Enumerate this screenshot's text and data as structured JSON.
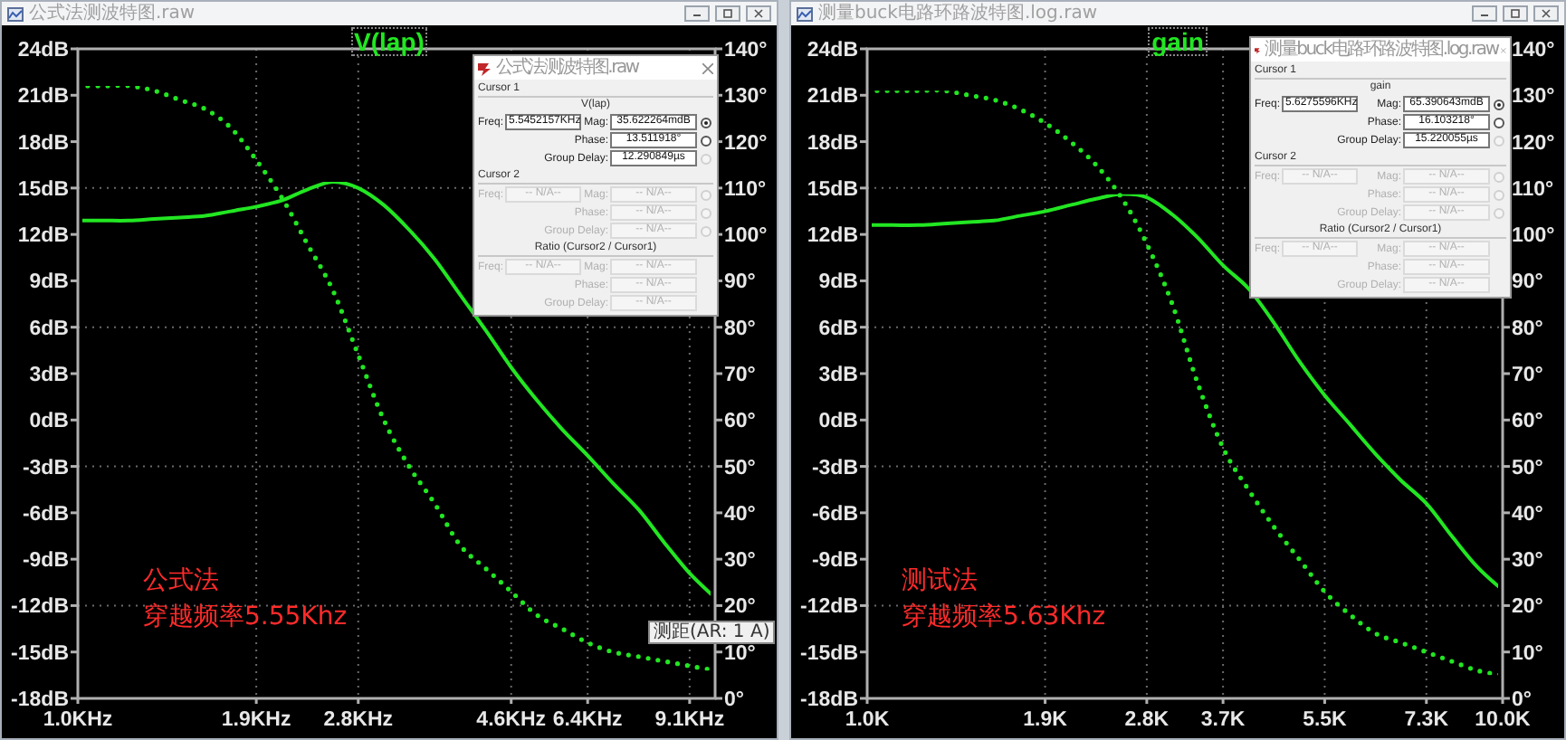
{
  "windows": [
    {
      "title": "公式法测波特图.raw",
      "plot": {
        "trace_label": "V(lap)",
        "chart_data": {
          "type": "line",
          "grid": true,
          "ylim": [
            -18,
            24
          ],
          "y2lim": [
            0,
            140
          ],
          "categories": [
            "1.0KHz",
            null,
            null,
            null,
            null,
            null,
            null,
            "1.9KHz",
            null,
            null,
            null,
            "2.8KHz",
            null,
            null,
            null,
            null,
            null,
            "4.6KHz",
            null,
            null,
            "6.4KHz",
            null,
            null,
            null,
            "9.1KHz",
            null
          ],
          "series": [
            {
              "color": "#22e622",
              "values": [
                12.9,
                12.9,
                12.9,
                13.0,
                13.1,
                13.2,
                13.5,
                13.8,
                14.2,
                14.9,
                15.4,
                15.0,
                13.9,
                12.3,
                10.4,
                8.1,
                5.8,
                3.4,
                1.3,
                -0.6,
                -2.3,
                -4.1,
                -5.8,
                -7.9,
                -9.9,
                -11.5
              ]
            },
            {
              "color": "#22e622",
              "axis": "y2",
              "line_style": "dotted",
              "values": [
                132,
                132,
                132,
                131,
                129,
                127,
                123,
                116,
                108,
                98,
                88,
                74,
                60,
                50,
                42,
                33,
                28,
                23,
                18,
                15,
                12,
                10,
                9,
                8,
                7,
                6
              ]
            }
          ],
          "yticks": [
            {
              "value": 24,
              "label": "24dB"
            },
            {
              "value": 21,
              "label": "21dB"
            },
            {
              "value": 18,
              "label": "18dB"
            },
            {
              "value": 15,
              "label": "15dB"
            },
            {
              "value": 12,
              "label": "12dB"
            },
            {
              "value": 9,
              "label": "9dB"
            },
            {
              "value": 6,
              "label": "6dB"
            },
            {
              "value": 3,
              "label": "3dB"
            },
            {
              "value": 0,
              "label": "0dB"
            },
            {
              "value": -3,
              "label": "-3dB"
            },
            {
              "value": -6,
              "label": "-6dB"
            },
            {
              "value": -9,
              "label": "-9dB"
            },
            {
              "value": -12,
              "label": "-12dB"
            },
            {
              "value": -15,
              "label": "-15dB"
            },
            {
              "value": -18,
              "label": "-18dB"
            }
          ],
          "y2ticks": [
            {
              "value": 140,
              "label": "140°"
            },
            {
              "value": 130,
              "label": "130°"
            },
            {
              "value": 120,
              "label": "120°"
            },
            {
              "value": 110,
              "label": "110°"
            },
            {
              "value": 100,
              "label": "100°"
            },
            {
              "value": 90,
              "label": "90°"
            },
            {
              "value": 80,
              "label": "80°"
            },
            {
              "value": 70,
              "label": "70°"
            },
            {
              "value": 60,
              "label": "60°"
            },
            {
              "value": 50,
              "label": "50°"
            },
            {
              "value": 40,
              "label": "40°"
            },
            {
              "value": 30,
              "label": "30°"
            },
            {
              "value": 20,
              "label": "20°"
            },
            {
              "value": 10,
              "label": "10°"
            },
            {
              "value": 0,
              "label": "0°"
            }
          ]
        }
      },
      "annotation": [
        "公式法",
        "穿越频率5.55Khz"
      ],
      "cursor_dialog": {
        "title": "公式法测波特图.raw",
        "sections": [
          {
            "kind": "cursor",
            "heading": "Cursor 1",
            "trace": "V(lap)",
            "fields": [
              {
                "label": "Freq:",
                "value": "5.5452157KHz",
                "disabled": false
              },
              {
                "label": "Mag:",
                "value": "35.622264mdB",
                "disabled": false,
                "radio": {
                  "selected": true,
                  "disabled": false
                }
              },
              {
                "label": "Phase:",
                "value": "13.511918°",
                "disabled": false,
                "radio": {
                  "selected": false,
                  "disabled": false
                }
              },
              {
                "label": "Group Delay:",
                "value": "12.290849µs",
                "disabled": false,
                "radio": {
                  "selected": false,
                  "disabled": true
                }
              }
            ]
          },
          {
            "kind": "cursor",
            "heading": "Cursor 2",
            "fields": [
              {
                "label": "Freq:",
                "value": "-- N/A--",
                "disabled": true
              },
              {
                "label": "Mag:",
                "value": "-- N/A--",
                "disabled": true,
                "radio": {
                  "selected": false,
                  "disabled": true
                }
              },
              {
                "label": "Phase:",
                "value": "-- N/A--",
                "disabled": true,
                "radio": {
                  "selected": false,
                  "disabled": true
                }
              },
              {
                "label": "Group Delay:",
                "value": "-- N/A--",
                "disabled": true,
                "radio": {
                  "selected": false,
                  "disabled": true
                }
              }
            ]
          },
          {
            "kind": "ratio",
            "heading": "Ratio (Cursor2 / Cursor1)",
            "fields": [
              {
                "label": "Freq:",
                "value": "-- N/A--",
                "disabled": true
              },
              {
                "label": "Mag:",
                "value": "-- N/A--",
                "disabled": true
              },
              {
                "label": "Phase:",
                "value": "-- N/A--",
                "disabled": true
              },
              {
                "label": "Group Delay:",
                "value": "-- N/A--",
                "disabled": true
              }
            ]
          }
        ]
      }
    },
    {
      "title": "测量buck电路环路波特图.log.raw",
      "plot": {
        "trace_label": "gain",
        "chart_data": {
          "type": "line",
          "grid": true,
          "ylim": [
            -18,
            24
          ],
          "y2lim": [
            0,
            140
          ],
          "categories": [
            "1.0K",
            null,
            null,
            null,
            null,
            null,
            null,
            "1.9K",
            null,
            null,
            null,
            "2.8K",
            null,
            null,
            "3.7K",
            null,
            null,
            null,
            "5.5K",
            null,
            null,
            null,
            "7.3K",
            null,
            null,
            "10.0K"
          ],
          "series": [
            {
              "color": "#22e622",
              "values": [
                12.6,
                12.6,
                12.6,
                12.7,
                12.8,
                12.9,
                13.2,
                13.5,
                13.9,
                14.3,
                14.6,
                14.4,
                13.3,
                11.8,
                10.0,
                8.5,
                6.3,
                3.8,
                1.6,
                -0.3,
                -2.2,
                -3.9,
                -5.4,
                -7.5,
                -9.5,
                -11.0
              ]
            },
            {
              "color": "#22e622",
              "axis": "y2",
              "line_style": "dotted",
              "values": [
                131,
                131,
                131,
                131,
                130,
                129,
                127,
                124,
                120,
                115,
                108,
                98,
                85,
                68,
                54,
                45,
                37,
                30,
                23,
                18,
                14,
                12,
                10,
                8,
                6,
                5
              ]
            }
          ],
          "yticks": [
            {
              "value": 24,
              "label": "24dB"
            },
            {
              "value": 21,
              "label": "21dB"
            },
            {
              "value": 18,
              "label": "18dB"
            },
            {
              "value": 15,
              "label": "15dB"
            },
            {
              "value": 12,
              "label": "12dB"
            },
            {
              "value": 9,
              "label": "9dB"
            },
            {
              "value": 6,
              "label": "6dB"
            },
            {
              "value": 3,
              "label": "3dB"
            },
            {
              "value": 0,
              "label": "0dB"
            },
            {
              "value": -3,
              "label": "-3dB"
            },
            {
              "value": -6,
              "label": "-6dB"
            },
            {
              "value": -9,
              "label": "-9dB"
            },
            {
              "value": -12,
              "label": "-12dB"
            },
            {
              "value": -15,
              "label": "-15dB"
            },
            {
              "value": -18,
              "label": "-18dB"
            }
          ],
          "y2ticks": [
            {
              "value": 140,
              "label": "140°"
            },
            {
              "value": 130,
              "label": "130°"
            },
            {
              "value": 120,
              "label": "120°"
            },
            {
              "value": 110,
              "label": "110°"
            },
            {
              "value": 100,
              "label": "100°"
            },
            {
              "value": 90,
              "label": "90°"
            },
            {
              "value": 80,
              "label": "80°"
            },
            {
              "value": 70,
              "label": "70°"
            },
            {
              "value": 60,
              "label": "60°"
            },
            {
              "value": 50,
              "label": "50°"
            },
            {
              "value": 40,
              "label": "40°"
            },
            {
              "value": 30,
              "label": "30°"
            },
            {
              "value": 20,
              "label": "20°"
            },
            {
              "value": 10,
              "label": "10°"
            },
            {
              "value": 0,
              "label": "0°"
            }
          ]
        }
      },
      "annotation": [
        "测试法",
        "穿越频率5.63Khz"
      ],
      "cursor_dialog": {
        "title": "测量buck电路环路波特图.log.raw",
        "sections": [
          {
            "kind": "cursor",
            "heading": "Cursor 1",
            "trace": "gain",
            "fields": [
              {
                "label": "Freq:",
                "value": "5.6275596KHz",
                "disabled": false
              },
              {
                "label": "Mag:",
                "value": "65.390643mdB",
                "disabled": false,
                "radio": {
                  "selected": true,
                  "disabled": false
                }
              },
              {
                "label": "Phase:",
                "value": "16.103218°",
                "disabled": false,
                "radio": {
                  "selected": false,
                  "disabled": false
                }
              },
              {
                "label": "Group Delay:",
                "value": "15.220055µs",
                "disabled": false,
                "radio": {
                  "selected": false,
                  "disabled": true
                }
              }
            ]
          },
          {
            "kind": "cursor",
            "heading": "Cursor 2",
            "fields": [
              {
                "label": "Freq:",
                "value": "-- N/A--",
                "disabled": true
              },
              {
                "label": "Mag:",
                "value": "-- N/A--",
                "disabled": true,
                "radio": {
                  "selected": false,
                  "disabled": true
                }
              },
              {
                "label": "Phase:",
                "value": "-- N/A--",
                "disabled": true,
                "radio": {
                  "selected": false,
                  "disabled": true
                }
              },
              {
                "label": "Group Delay:",
                "value": "-- N/A--",
                "disabled": true,
                "radio": {
                  "selected": false,
                  "disabled": true
                }
              }
            ]
          },
          {
            "kind": "ratio",
            "heading": "Ratio (Cursor2 / Cursor1)",
            "fields": [
              {
                "label": "Freq:",
                "value": "-- N/A--",
                "disabled": true
              },
              {
                "label": "Mag:",
                "value": "-- N/A--",
                "disabled": true
              },
              {
                "label": "Phase:",
                "value": "-- N/A--",
                "disabled": true
              },
              {
                "label": "Group Delay:",
                "value": "-- N/A--",
                "disabled": true
              }
            ]
          }
        ]
      }
    }
  ],
  "tooltip": "测距(AR: 1 A)"
}
